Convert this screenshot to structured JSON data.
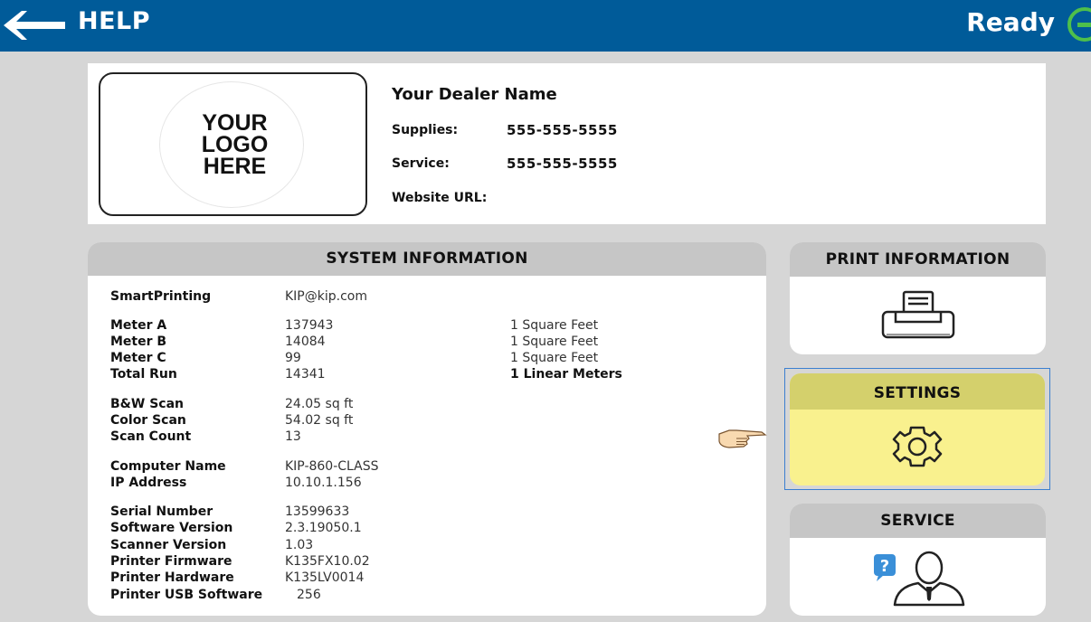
{
  "topbar": {
    "back_icon": "arrow-left-icon",
    "title": "HELP",
    "status": "Ready",
    "status_icon": "ready-status-icon",
    "bg_color": "#005b99"
  },
  "dealer": {
    "logo_text_1": "YOUR",
    "logo_text_2": "LOGO",
    "logo_text_3": "HERE",
    "name": "Your Dealer Name",
    "supplies_label": "Supplies:",
    "supplies_value": "555-555-5555",
    "service_label": "Service:",
    "service_value": "555-555-5555",
    "website_label": "Website URL:",
    "website_value": ""
  },
  "system_info": {
    "title": "SYSTEM INFORMATION",
    "rows": [
      {
        "label": "SmartPrinting",
        "value": "KIP@kip.com",
        "unit": ""
      },
      {
        "label": "Meter A",
        "value": "137943",
        "unit": "1 Square Feet"
      },
      {
        "label": "Meter B",
        "value": "14084",
        "unit": "1 Square Feet"
      },
      {
        "label": "Meter C",
        "value": "99",
        "unit": "1 Square Feet"
      },
      {
        "label": "Total Run",
        "value": "14341",
        "unit": "1 Linear Meters"
      },
      {
        "label": "B&W Scan",
        "value": "24.05 sq ft",
        "unit": ""
      },
      {
        "label": "Color Scan",
        "value": "54.02 sq ft",
        "unit": ""
      },
      {
        "label": "Scan Count",
        "value": "13",
        "unit": ""
      },
      {
        "label": "Computer Name",
        "value": "KIP-860-CLASS",
        "unit": ""
      },
      {
        "label": "IP Address",
        "value": "10.10.1.156",
        "unit": ""
      },
      {
        "label": "Serial Number",
        "value": "13599633",
        "unit": ""
      },
      {
        "label": "Software Version",
        "value": "2.3.19050.1",
        "unit": ""
      },
      {
        "label": "Scanner Version",
        "value": "1.03",
        "unit": ""
      },
      {
        "label": "Printer Firmware",
        "value": "K135FX10.02",
        "unit": ""
      },
      {
        "label": "Printer Hardware",
        "value": "K135LV0014",
        "unit": ""
      },
      {
        "label": "Printer USB Software",
        "value": "256",
        "unit": ""
      }
    ]
  },
  "cards": {
    "print_title": "PRINT INFORMATION",
    "print_icon": "printer-icon",
    "settings_title": "SETTINGS",
    "settings_icon": "gear-icon",
    "service_title": "SERVICE",
    "service_icon": "help-person-icon",
    "pointer_icon": "pointing-hand-icon",
    "settings_highlight_color": "#f9f18e"
  }
}
